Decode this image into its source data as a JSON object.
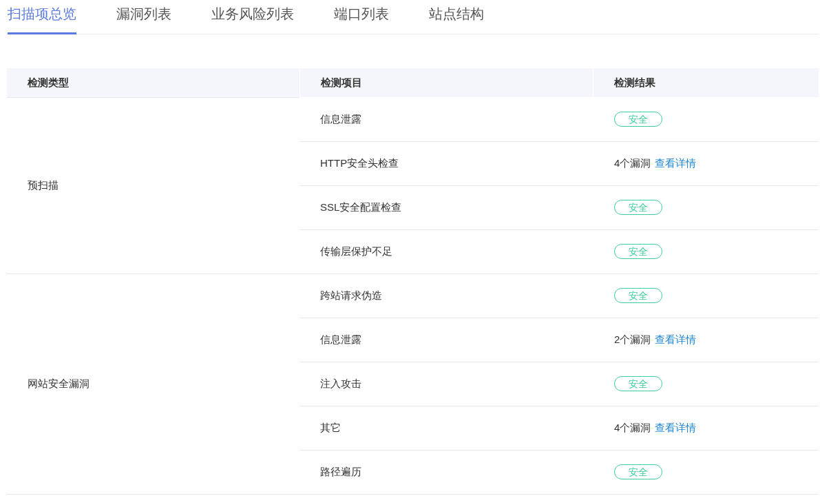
{
  "tabs": [
    {
      "label": "扫描项总览",
      "selected": true
    },
    {
      "label": "漏洞列表",
      "selected": false
    },
    {
      "label": "业务风险列表",
      "selected": false
    },
    {
      "label": "端口列表",
      "selected": false
    },
    {
      "label": "站点结构",
      "selected": false
    }
  ],
  "table": {
    "columns": [
      "检测类型",
      "检测项目",
      "检测结果"
    ],
    "groups": [
      {
        "type": "预扫描",
        "rows": [
          {
            "item": "信息泄露",
            "result": {
              "kind": "safe",
              "badge": "安全"
            }
          },
          {
            "item": "HTTP安全头检查",
            "result": {
              "kind": "vulns",
              "count": "4个漏洞",
              "link": "查看详情"
            }
          },
          {
            "item": "SSL安全配置检查",
            "result": {
              "kind": "safe",
              "badge": "安全"
            }
          },
          {
            "item": "传输层保护不足",
            "result": {
              "kind": "safe",
              "badge": "安全"
            }
          }
        ]
      },
      {
        "type": "网站安全漏洞",
        "rows": [
          {
            "item": "跨站请求伪造",
            "result": {
              "kind": "safe",
              "badge": "安全"
            }
          },
          {
            "item": "信息泄露",
            "result": {
              "kind": "vulns",
              "count": "2个漏洞",
              "link": "查看详情"
            }
          },
          {
            "item": "注入攻击",
            "result": {
              "kind": "safe",
              "badge": "安全"
            }
          },
          {
            "item": "其它",
            "result": {
              "kind": "vulns",
              "count": "4个漏洞",
              "link": "查看详情"
            }
          },
          {
            "item": "路径遍历",
            "result": {
              "kind": "safe",
              "badge": "安全"
            }
          }
        ]
      }
    ]
  }
}
